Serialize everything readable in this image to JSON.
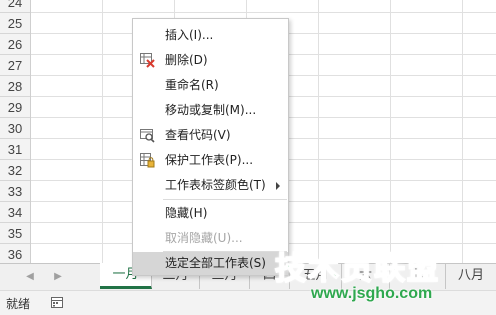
{
  "sheet": {
    "row_numbers": [
      "24",
      "25",
      "26",
      "27",
      "28",
      "29",
      "30",
      "31",
      "32",
      "33",
      "34",
      "35",
      "36",
      "37"
    ]
  },
  "tabs": {
    "left_arrow": "◀",
    "right_arrow": "▶",
    "items": [
      "一月",
      "二月",
      "三月",
      "四",
      "五月",
      "六",
      "七",
      "八月"
    ],
    "active": "一月"
  },
  "status": {
    "text": "就绪",
    "macro_icon": "macro-record-icon"
  },
  "context_menu": {
    "items": [
      {
        "label": "插入(I)...",
        "icon": "",
        "disabled": false
      },
      {
        "label": "删除(D)",
        "icon": "delete-sheet-icon",
        "disabled": false
      },
      {
        "label": "重命名(R)",
        "icon": "",
        "disabled": false
      },
      {
        "label": "移动或复制(M)...",
        "icon": "",
        "disabled": false
      },
      {
        "label": "查看代码(V)",
        "icon": "view-code-icon",
        "disabled": false
      },
      {
        "label": "保护工作表(P)...",
        "icon": "protect-sheet-icon",
        "disabled": false
      },
      {
        "label": "工作表标签颜色(T)",
        "icon": "",
        "disabled": false,
        "submenu": true
      },
      {
        "label": "隐藏(H)",
        "icon": "",
        "disabled": false
      },
      {
        "label": "取消隐藏(U)...",
        "icon": "",
        "disabled": true
      },
      {
        "label": "选定全部工作表(S)",
        "icon": "",
        "disabled": false,
        "highlighted": true
      }
    ]
  },
  "watermark": {
    "title": "技术员联盟",
    "url": "www.jsgho.com"
  },
  "colors": {
    "accent": "#217346",
    "watermark": "#2fa84f",
    "menu_highlight": "#d6d6d6"
  }
}
